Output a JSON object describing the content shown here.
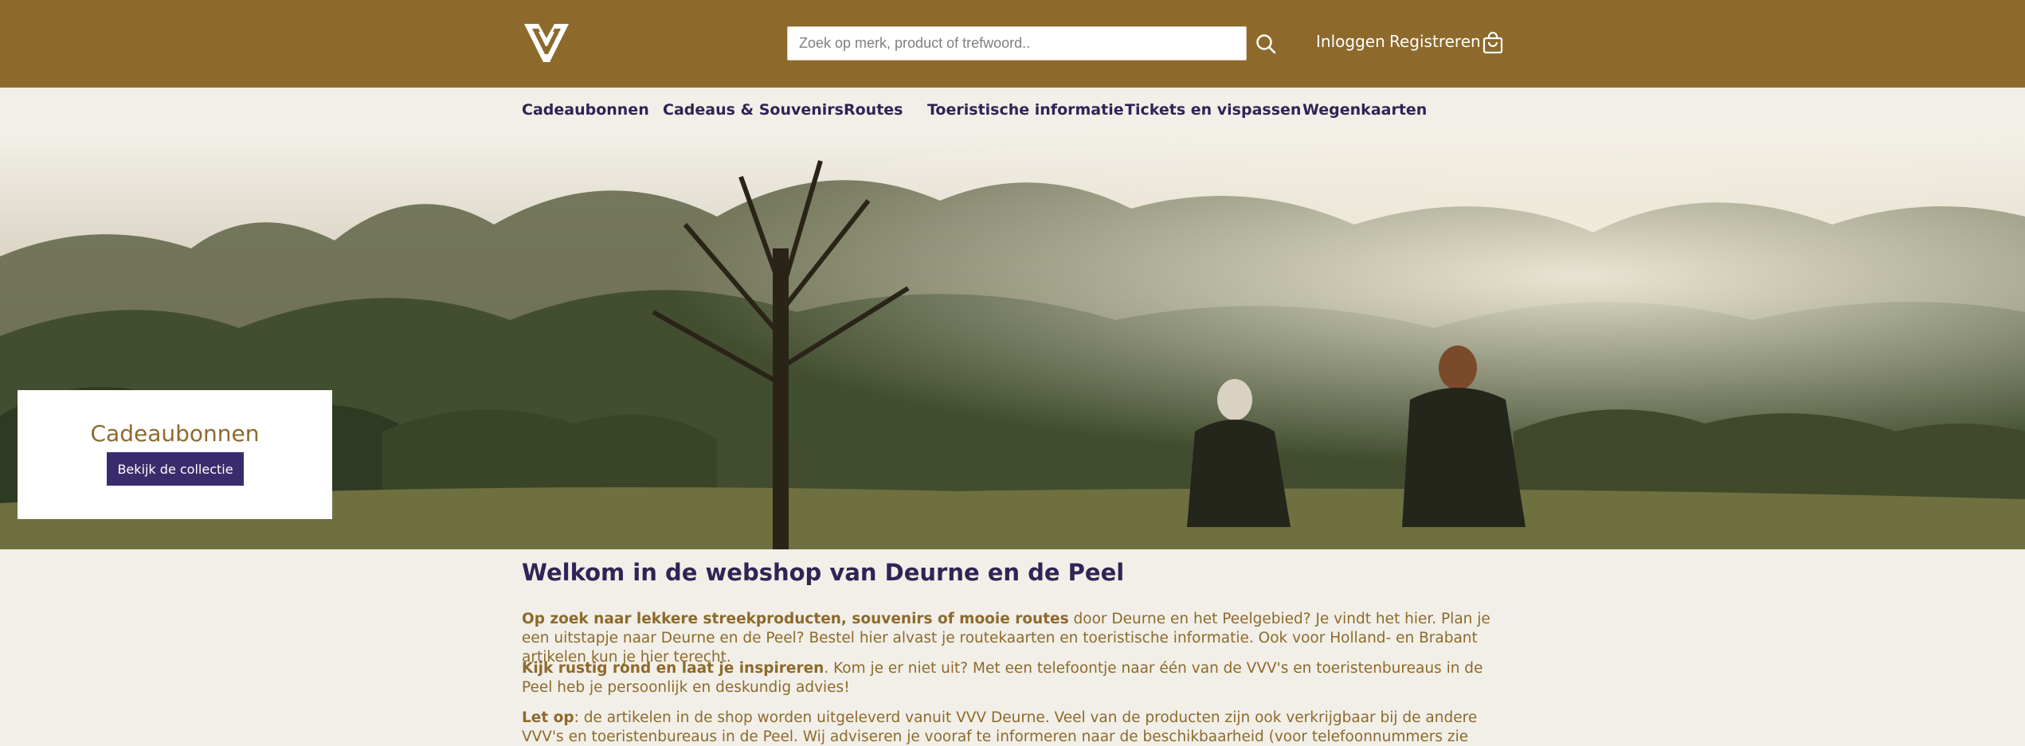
{
  "header": {
    "search_placeholder": "Zoek op merk, product of trefwoord..",
    "login_label": "Inloggen",
    "register_label": "Registreren",
    "brand_color": "#8d6a2c"
  },
  "nav": {
    "items": [
      {
        "label": "Cadeaubonnen"
      },
      {
        "label": "Cadeaus & Souvenirs"
      },
      {
        "label": "Routes"
      },
      {
        "label": "Toeristische informatie"
      },
      {
        "label": "Tickets en vispassen"
      },
      {
        "label": "Wegenkaarten"
      }
    ]
  },
  "hero": {
    "promo_title": "Cadeaubonnen",
    "promo_button": "Bekijk de collectie",
    "slide_count": 5,
    "active_slide": 1
  },
  "content": {
    "heading": "Welkom in de webshop van Deurne en de Peel",
    "p1_bold": "Op zoek naar lekkere streekproducten, souvenirs of mooie routes",
    "p1_rest": " door Deurne en het Peelgebied? Je vindt het hier. Plan je een uitstapje naar Deurne en de Peel? Bestel hier alvast je routekaarten en toeristische informatie. Ook voor Holland- en Brabant artikelen kun je hier terecht.",
    "p2_bold": "Kijk rustig rond en laat je inspireren",
    "p2_rest": ". Kom je er niet uit? Met een telefoontje naar één van de VVV's en toeristenbureaus in de Peel heb je persoonlijk en deskundig advies!",
    "p3_bold": "Let op",
    "p3_rest": ": de artikelen in de shop worden uitgeleverd vanuit VVV Deurne. Veel van de producten zijn ook verkrijgbaar bij de andere VVV's en toeristenbureaus in de Peel. Wij adviseren je vooraf te informeren naar de beschikbaarheid (voor telefoonnummers zie 'Over Ons')."
  },
  "colors": {
    "accent": "#3a2c6c",
    "text_gold": "#8d6a2c",
    "page_bg": "#f2efe8"
  }
}
